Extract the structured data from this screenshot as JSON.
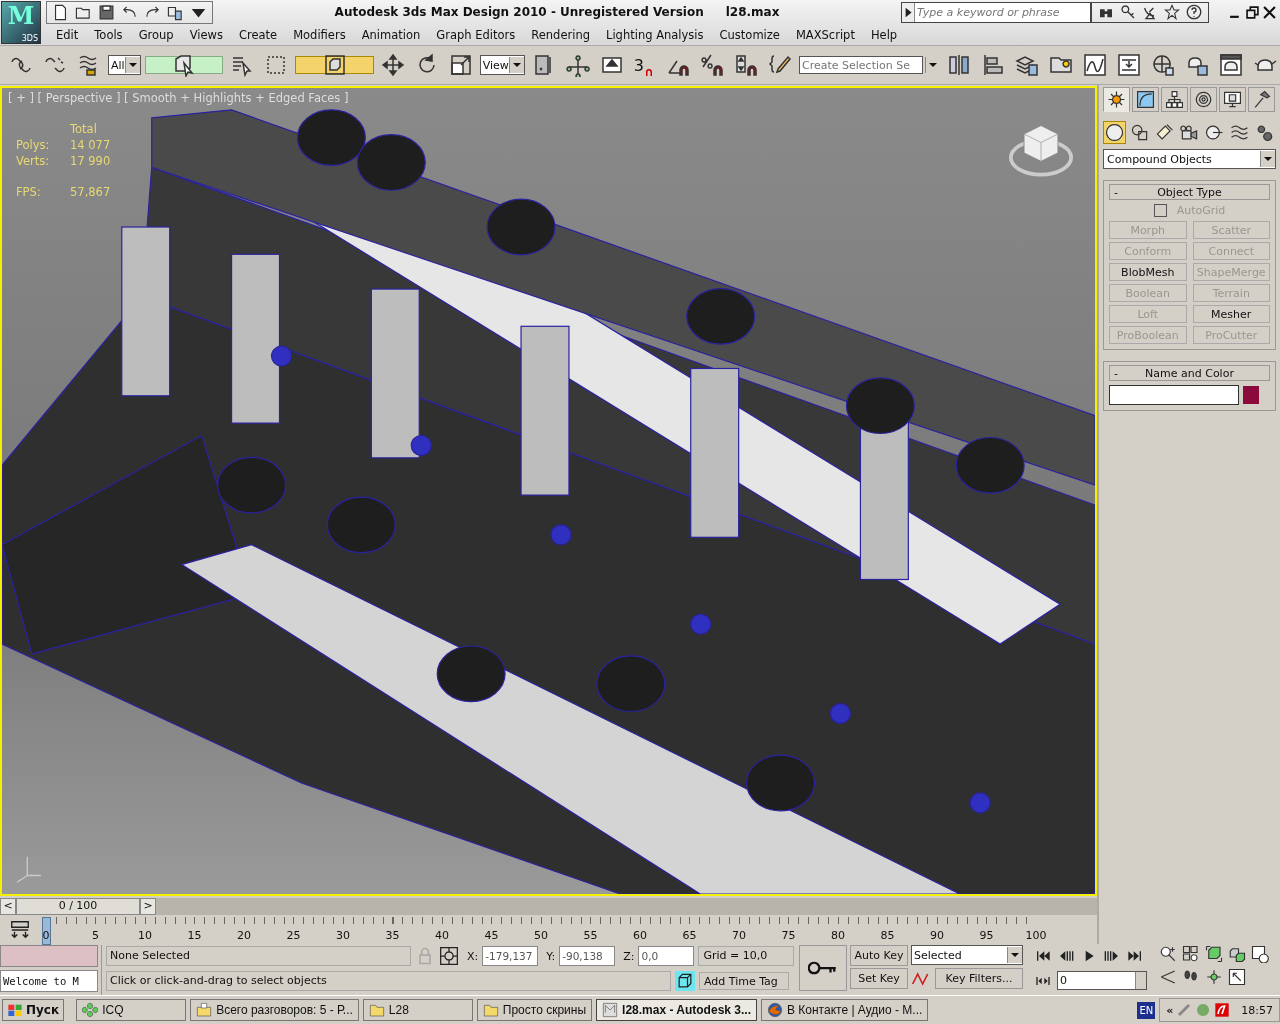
{
  "app_button": {
    "logo": "M",
    "label": "3DS"
  },
  "window": {
    "title": "Autodesk 3ds Max Design 2010  - Unregistered Version",
    "file": "l28.max"
  },
  "search": {
    "placeholder": "Type a keyword or phrase"
  },
  "menu": [
    "Edit",
    "Tools",
    "Group",
    "Views",
    "Create",
    "Modifiers",
    "Animation",
    "Graph Editors",
    "Rendering",
    "Lighting Analysis",
    "Customize",
    "MAXScript",
    "Help"
  ],
  "toolbar": [
    {
      "kind": "link",
      "selected": false
    },
    {
      "kind": "unlink",
      "selected": false
    },
    {
      "kind": "bind",
      "selected": false
    },
    {
      "kind": "dropdown",
      "value": "All"
    },
    {
      "kind": "select",
      "selected": true
    },
    {
      "kind": "select-by-name",
      "selected": false
    },
    {
      "kind": "region",
      "selected": false
    },
    {
      "kind": "crossing",
      "selected": true
    },
    {
      "kind": "move",
      "selected": false
    },
    {
      "kind": "rotate",
      "selected": false
    },
    {
      "kind": "scale",
      "selected": false
    },
    {
      "kind": "dropdown",
      "value": "View"
    },
    {
      "kind": "pivot",
      "selected": false
    },
    {
      "kind": "manipulate",
      "selected": false
    },
    {
      "kind": "keyboard",
      "selected": false
    },
    {
      "kind": "snap",
      "label": "3",
      "selected": false
    },
    {
      "kind": "angle-snap",
      "selected": false
    },
    {
      "kind": "percent-snap",
      "selected": false
    },
    {
      "kind": "spinner-snap",
      "selected": false
    },
    {
      "kind": "named-sets",
      "selected": false
    },
    {
      "kind": "field",
      "placeholder": "Create Selection Se"
    },
    {
      "kind": "mirror",
      "selected": false
    },
    {
      "kind": "align",
      "selected": false
    },
    {
      "kind": "layers",
      "selected": false
    },
    {
      "kind": "explorer",
      "selected": false
    },
    {
      "kind": "curve-editor",
      "selected": false
    },
    {
      "kind": "schematic",
      "selected": false
    },
    {
      "kind": "material",
      "selected": false
    },
    {
      "kind": "render-setup",
      "selected": false
    },
    {
      "kind": "render-frame",
      "selected": false
    },
    {
      "kind": "render",
      "selected": false
    }
  ],
  "viewport": {
    "label": "[ + ] [ Perspective ] [ Smooth + Highlights + Edged Faces ]",
    "active": true,
    "stats": {
      "header": "Total",
      "rows": [
        {
          "label": "Polys:",
          "value": "14 077"
        },
        {
          "label": "Verts:",
          "value": "17 990"
        }
      ],
      "fps_label": "FPS:",
      "fps": "57,867"
    }
  },
  "command_panel": {
    "tabs": [
      {
        "kind": "create",
        "selected": true
      },
      {
        "kind": "modify",
        "selected": false
      },
      {
        "kind": "hierarchy",
        "selected": false
      },
      {
        "kind": "motion",
        "selected": false
      },
      {
        "kind": "display",
        "selected": false
      },
      {
        "kind": "utilities",
        "selected": false
      }
    ],
    "categories": [
      {
        "kind": "geometry",
        "selected": true
      },
      {
        "kind": "shapes",
        "selected": false
      },
      {
        "kind": "lights",
        "selected": false
      },
      {
        "kind": "cameras",
        "selected": false
      },
      {
        "kind": "helpers",
        "selected": false
      },
      {
        "kind": "spacewarps",
        "selected": false
      },
      {
        "kind": "systems",
        "selected": false
      }
    ],
    "type_dropdown": "Compound Objects",
    "object_type": {
      "collapse": "-",
      "title": "Object Type",
      "autogrid": {
        "label": "AutoGrid",
        "checked": false,
        "disabled": true
      },
      "buttons": [
        {
          "label": "Morph",
          "disabled": true
        },
        {
          "label": "Scatter",
          "disabled": true
        },
        {
          "label": "Conform",
          "disabled": true
        },
        {
          "label": "Connect",
          "disabled": true
        },
        {
          "label": "BlobMesh",
          "disabled": false
        },
        {
          "label": "ShapeMerge",
          "disabled": true
        },
        {
          "label": "Boolean",
          "disabled": true
        },
        {
          "label": "Terrain",
          "disabled": true
        },
        {
          "label": "Loft",
          "disabled": true
        },
        {
          "label": "Mesher",
          "disabled": false
        },
        {
          "label": "ProBoolean",
          "disabled": true
        },
        {
          "label": "ProCutter",
          "disabled": true
        }
      ]
    },
    "name_and_color": {
      "collapse": "-",
      "title": "Name and Color",
      "color": "#8a0a3c"
    }
  },
  "timeline": {
    "prev": "<",
    "frame": "0 / 100",
    "next": ">",
    "ticks": [
      "0",
      "5",
      "10",
      "15",
      "20",
      "25",
      "30",
      "35",
      "40",
      "45",
      "50",
      "55",
      "60",
      "65",
      "70",
      "75",
      "80",
      "85",
      "90",
      "95",
      "100"
    ]
  },
  "status": {
    "listener": "Welcome to M",
    "selection": "None Selected",
    "prompt": "Click or click-and-drag to select objects",
    "coords": [
      {
        "label": "X:",
        "value": "-179,137"
      },
      {
        "label": "Y:",
        "value": "-90,138"
      },
      {
        "label": "Z:",
        "value": "0,0"
      }
    ],
    "grid": "Grid = 10,0",
    "time_tag": "Add Time Tag",
    "auto_key": "Auto Key",
    "set_key": "Set Key",
    "key_mode": "Selected",
    "key_filters": "Key Filters...",
    "current_frame": "0"
  },
  "taskbar": {
    "start": "Пуск",
    "tasks": [
      {
        "kind": "icq",
        "label": "ICQ",
        "selected": false
      },
      {
        "kind": "chat",
        "label": "Всего разговоров: 5 - Р...",
        "selected": false
      },
      {
        "kind": "folder",
        "label": "L28",
        "selected": false
      },
      {
        "kind": "folder",
        "label": "Просто скрины",
        "selected": false
      },
      {
        "kind": "max",
        "label": "l28.max - Autodesk 3...",
        "selected": true
      },
      {
        "kind": "browser",
        "label": "В Контакте | Аудио - М...",
        "selected": false
      }
    ],
    "language": "EN",
    "expand": "«",
    "clock": "18:57"
  }
}
